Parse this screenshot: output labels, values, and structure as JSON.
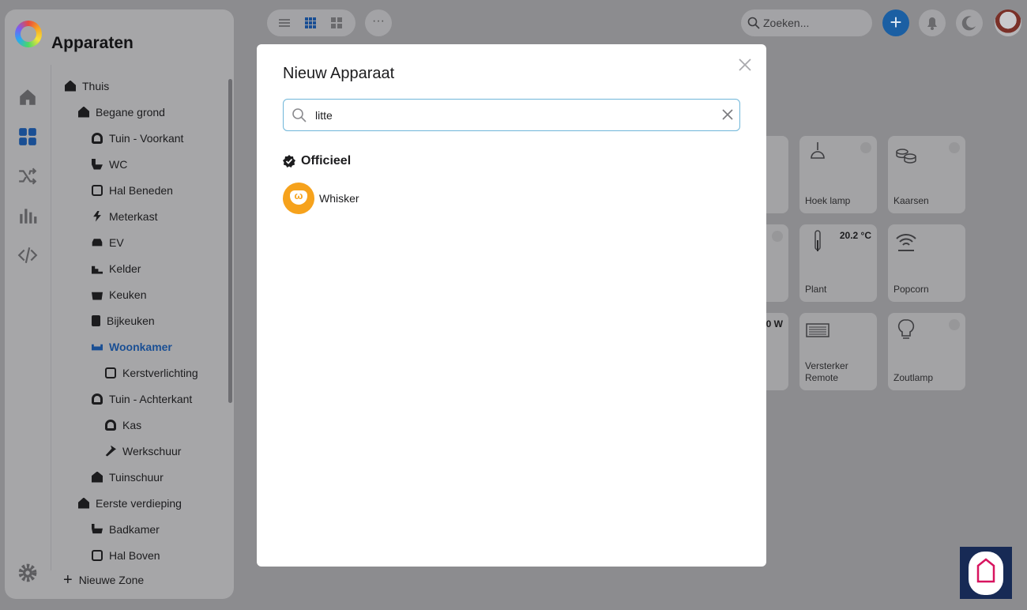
{
  "app": {
    "title": "Apparaten"
  },
  "toolbar": {
    "view_icons": [
      "list-view-icon",
      "grid-small-view-icon",
      "grid-large-view-icon"
    ],
    "more_label": "···",
    "search_placeholder": "Zoeken...",
    "add_label": "+",
    "accent_color": "#1b5fa3"
  },
  "rail": {
    "icons": [
      "home-icon",
      "devices-icon",
      "flows-icon",
      "insights-icon",
      "developer-icon",
      "settings-icon"
    ]
  },
  "zones": [
    {
      "label": "Thuis",
      "icon": "house-icon",
      "level": 0
    },
    {
      "label": "Begane grond",
      "icon": "floor-icon",
      "level": 1
    },
    {
      "label": "Tuin - Voorkant",
      "icon": "plant-icon",
      "level": 2
    },
    {
      "label": "WC",
      "icon": "toilet-icon",
      "level": 2
    },
    {
      "label": "Hal Beneden",
      "icon": "door-icon",
      "level": 2
    },
    {
      "label": "Meterkast",
      "icon": "bolt-icon",
      "level": 2
    },
    {
      "label": "EV",
      "icon": "car-icon",
      "level": 2
    },
    {
      "label": "Kelder",
      "icon": "stairs-icon",
      "level": 2
    },
    {
      "label": "Keuken",
      "icon": "pot-icon",
      "level": 2
    },
    {
      "label": "Bijkeuken",
      "icon": "washer-icon",
      "level": 2
    },
    {
      "label": "Woonkamer",
      "icon": "sofa-icon",
      "level": 2,
      "active": true
    },
    {
      "label": "Kerstverlichting",
      "icon": "door-icon",
      "level": 3
    },
    {
      "label": "Tuin - Achterkant",
      "icon": "plant-icon",
      "level": 2
    },
    {
      "label": "Kas",
      "icon": "plant-icon",
      "level": 3
    },
    {
      "label": "Werkschuur",
      "icon": "hammer-icon",
      "level": 3
    },
    {
      "label": "Tuinschuur",
      "icon": "shed-icon",
      "level": 2
    },
    {
      "label": "Eerste verdieping",
      "icon": "floor-icon",
      "level": 1
    },
    {
      "label": "Badkamer",
      "icon": "bath-icon",
      "level": 2
    },
    {
      "label": "Hal Boven",
      "icon": "door-icon",
      "level": 2
    }
  ],
  "new_zone": {
    "plus": "+",
    "label": "Nieuwe Zone"
  },
  "devices": [
    {
      "name": "Hoek lamp",
      "icon": "pendant-lamp-icon",
      "value": ""
    },
    {
      "name": "Kaarsen",
      "icon": "candles-icon",
      "value": ""
    },
    {
      "name": "Plant",
      "icon": "thermometer-icon",
      "value": "20.2 °C"
    },
    {
      "name": "Popcorn",
      "icon": "wifi-icon",
      "value": ""
    },
    {
      "name": "Versterker\nRemote",
      "icon": "amplifier-icon",
      "value": ""
    },
    {
      "name": "Zoutlamp",
      "icon": "bulb-icon",
      "value": ""
    }
  ],
  "partial_card_value": "0 W",
  "modal": {
    "title": "Nieuw Apparaat",
    "search_value": "litte",
    "section": "Officieel",
    "results": [
      {
        "name": "Whisker",
        "logo_text": "ω",
        "color": "#f6a21c"
      }
    ]
  }
}
